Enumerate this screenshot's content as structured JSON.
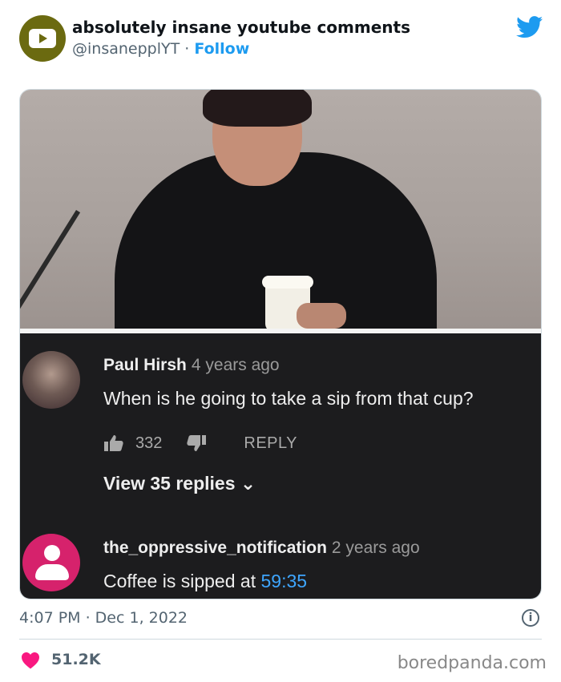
{
  "tweet": {
    "author_name": "absolutely insane youtube comments",
    "author_handle": "@insanepplYT",
    "separator": "·",
    "follow_label": "Follow",
    "timestamp": "4:07 PM · Dec 1, 2022",
    "likes": "51.2K",
    "info_glyph": "i"
  },
  "media": {
    "comments": [
      {
        "author": "Paul Hirsh",
        "age": "4 years ago",
        "text": "When is he going to take a sip from that cup?",
        "likes": "332",
        "reply_label": "REPLY",
        "view_replies": "View 35 replies ⌄"
      },
      {
        "author": "the_oppressive_notification",
        "age": "2 years ago",
        "text_prefix": "Coffee is sipped at",
        "timestamp_link": "59:35"
      }
    ]
  },
  "watermark": "boredpanda.com",
  "colors": {
    "accent": "#1d9bf0",
    "heart": "#f91880",
    "yt_link": "#3ea6ff",
    "comment_bg": "#1c1c1e"
  },
  "icons": [
    "youtube-logo-icon",
    "twitter-bird-icon",
    "thumb-up-icon",
    "thumb-down-icon",
    "info-icon",
    "heart-icon"
  ]
}
